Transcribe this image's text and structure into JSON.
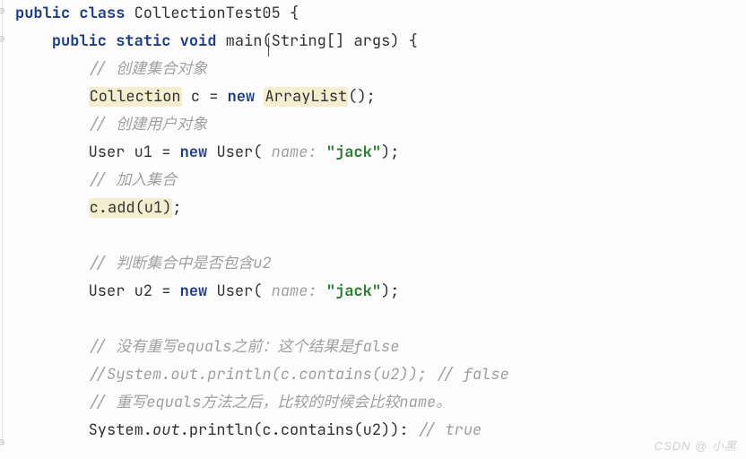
{
  "code": {
    "l1": {
      "kw1": "public",
      "kw2": "class",
      "name": "CollectionTest05",
      "brace": " {"
    },
    "l2": {
      "indent": "    ",
      "kw1": "public",
      "kw2": "static",
      "kw3": "void",
      "method": "main",
      "paren1": "(",
      "type": "String",
      "arr": "[]",
      "arg": " args",
      "paren2": ")",
      "brace": " {"
    },
    "l3": {
      "indent": "        ",
      "slashes": "// ",
      "text": "创建集合对象"
    },
    "l4": {
      "indent": "        ",
      "t1": "Collection",
      "sp1": " ",
      "var": "c",
      "assign": " = ",
      "kw": "new",
      "sp2": " ",
      "t2": "ArrayList",
      "tail": "();"
    },
    "l5": {
      "indent": "        ",
      "slashes": "// ",
      "text": "创建用户对象"
    },
    "l6": {
      "indent": "        ",
      "t1": "User ",
      "var": "u1",
      "assign": " = ",
      "kw": "new",
      "sp": " ",
      "t2": "User(",
      "hint": " name: ",
      "str": "\"jack\"",
      "tail": ");"
    },
    "l7": {
      "indent": "        ",
      "slashes": "// ",
      "text": "加入集合"
    },
    "l8": {
      "indent": "        ",
      "call": "c.add(u1)",
      "semi": ";"
    },
    "l9": {
      "indent": ""
    },
    "l10": {
      "indent": "        ",
      "slashes": "// ",
      "text": "判断集合中是否包含u2"
    },
    "l11": {
      "indent": "        ",
      "t1": "User ",
      "var": "u2",
      "assign": " = ",
      "kw": "new",
      "sp": " ",
      "t2": "User(",
      "hint": " name: ",
      "str": "\"jack\"",
      "tail": ");"
    },
    "l12": {
      "indent": ""
    },
    "l13": {
      "indent": "        ",
      "slashes": "// ",
      "text": "没有重写equals之前：这个结果是false"
    },
    "l14": {
      "indent": "        ",
      "text": "//System.out.println(c.contains(u2)); // false"
    },
    "l15": {
      "indent": "        ",
      "slashes": "// ",
      "text": "重写equals方法之后，比较的时候会比较name。"
    },
    "l16": {
      "indent": "        ",
      "t1": "System.",
      "out": "out",
      "t2": ".println(c.contains(u2)): ",
      "cmt": "// true"
    }
  },
  "watermark": "CSDN @ 小黑"
}
